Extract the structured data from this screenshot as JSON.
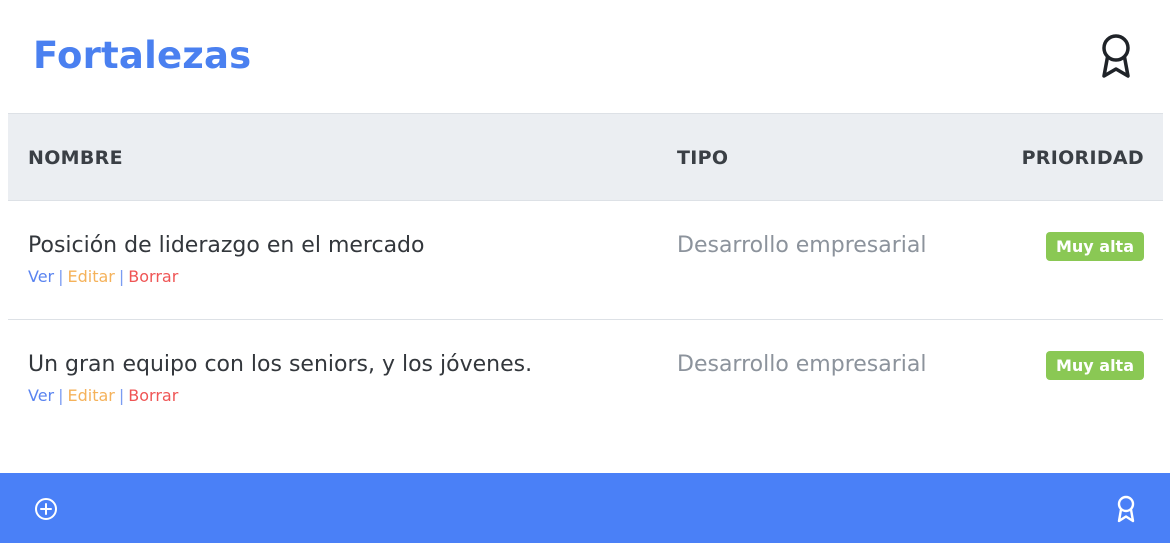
{
  "header": {
    "title": "Fortalezas",
    "icon": "award-icon"
  },
  "table": {
    "columns": {
      "nombre": "NOMBRE",
      "tipo": "TIPO",
      "prioridad": "PRIORIDAD"
    },
    "rows": [
      {
        "nombre": "Posición de liderazgo en el mercado",
        "tipo": "Desarrollo empresarial",
        "prioridad": "Muy alta",
        "actions": {
          "ver": "Ver",
          "editar": "Editar",
          "borrar": "Borrar",
          "separator": "|"
        }
      },
      {
        "nombre": "Un gran equipo con los seniors, y los jóvenes.",
        "tipo": "Desarrollo empresarial",
        "prioridad": "Muy alta",
        "actions": {
          "ver": "Ver",
          "editar": "Editar",
          "borrar": "Borrar",
          "separator": "|"
        }
      }
    ]
  },
  "footer": {
    "add_icon": "plus-circle-icon",
    "award_icon": "award-icon"
  },
  "colors": {
    "accent": "#4a80f0",
    "footer_bg": "#4a80f7",
    "badge_green": "#8ac854",
    "action_ver": "#5a84f0",
    "action_editar": "#f5b25a",
    "action_borrar": "#ef5555"
  }
}
